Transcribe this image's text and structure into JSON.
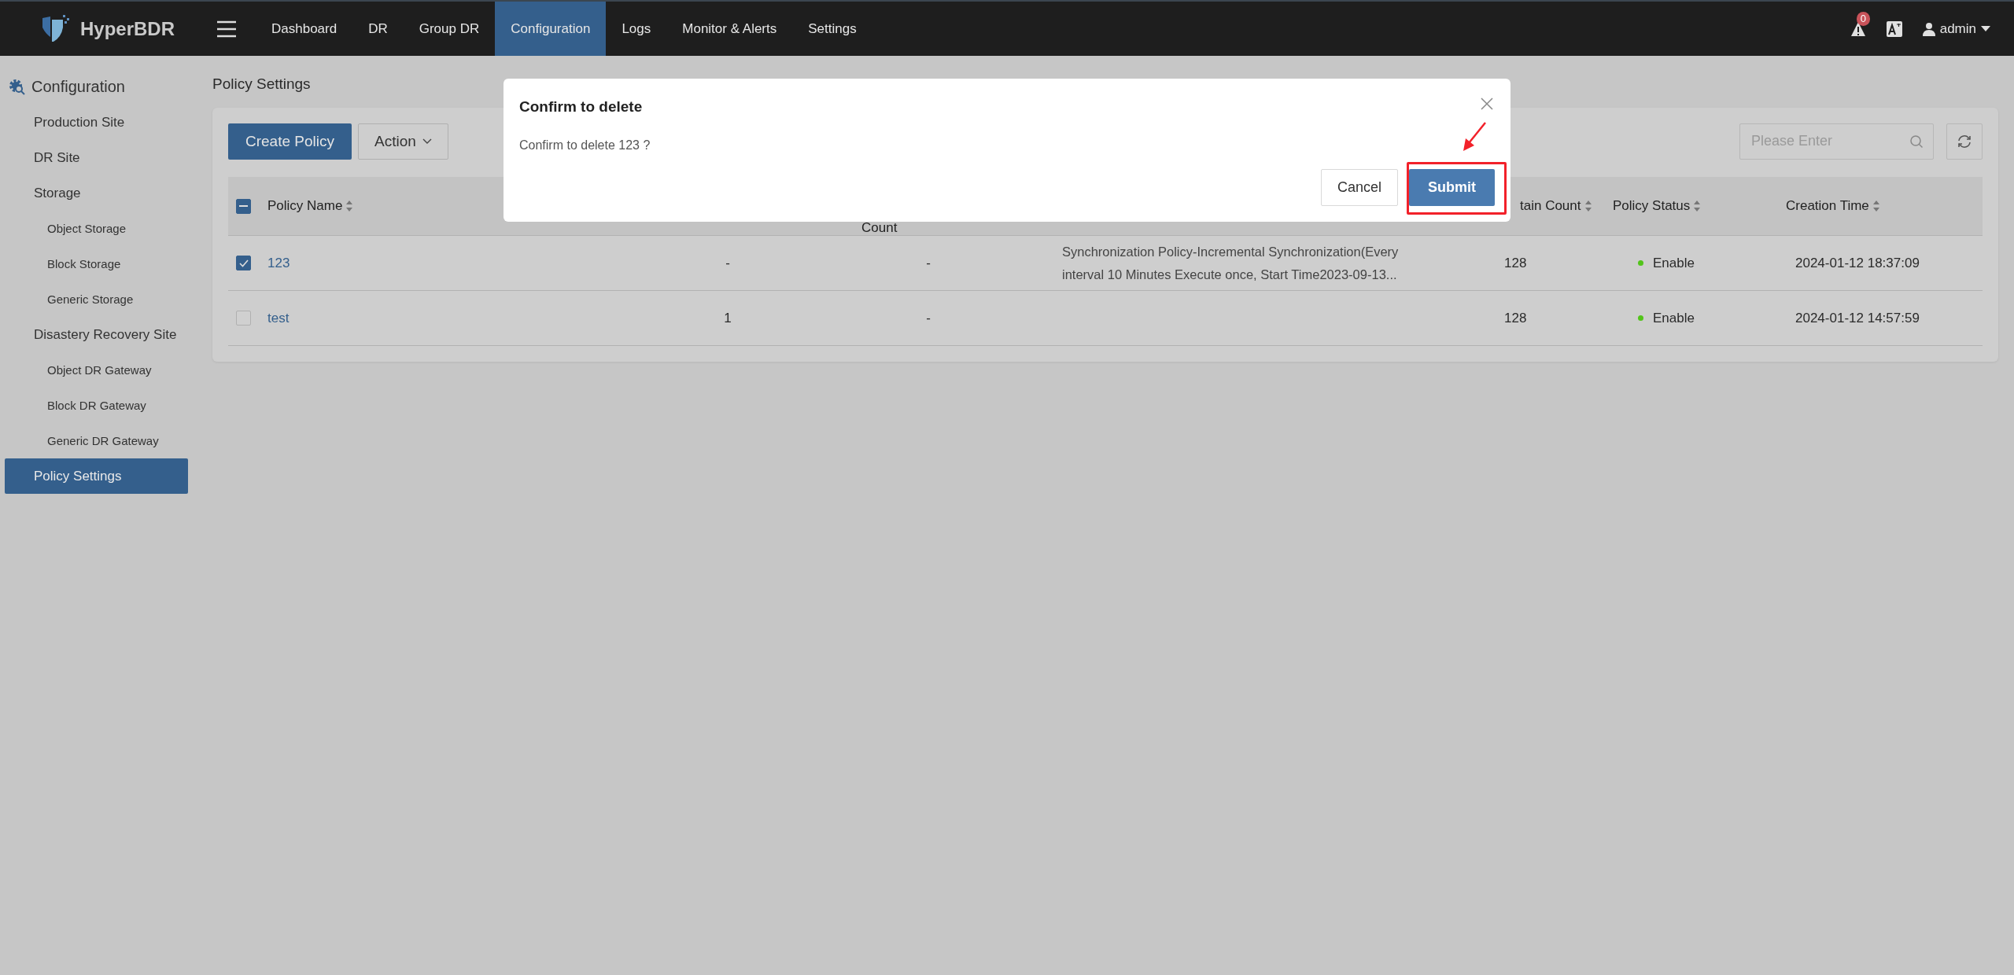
{
  "app": {
    "name": "HyperBDR"
  },
  "nav": [
    {
      "label": "Dashboard",
      "selected": false
    },
    {
      "label": "DR",
      "selected": false
    },
    {
      "label": "Group DR",
      "selected": false
    },
    {
      "label": "Configuration",
      "selected": true
    },
    {
      "label": "Logs",
      "selected": false
    },
    {
      "label": "Monitor & Alerts",
      "selected": false
    },
    {
      "label": "Settings",
      "selected": false
    }
  ],
  "topbar": {
    "alert_count": "0",
    "user": "admin"
  },
  "sidebar": {
    "title": "Configuration",
    "items": [
      {
        "label": "Production Site",
        "selected": false
      },
      {
        "label": "DR Site",
        "selected": false
      },
      {
        "label": "Storage",
        "selected": false,
        "children": [
          {
            "label": "Object Storage",
            "selected": false
          },
          {
            "label": "Block Storage",
            "selected": false
          },
          {
            "label": "Generic Storage",
            "selected": false
          }
        ]
      },
      {
        "label": "Disastery Recovery Site",
        "selected": false,
        "children": [
          {
            "label": "Object DR Gateway",
            "selected": false
          },
          {
            "label": "Block DR Gateway",
            "selected": false
          },
          {
            "label": "Generic DR Gateway",
            "selected": false
          }
        ]
      },
      {
        "label": "Policy Settings",
        "selected": true
      }
    ]
  },
  "page_title": "Policy Settings",
  "toolbar": {
    "create_button": "Create Policy",
    "action_button": "Action",
    "search": {
      "placeholder": "Please Enter"
    }
  },
  "table": {
    "select_all": {
      "indeterminate": true
    },
    "header": {
      "policy_name": "Policy Name",
      "column_3": "Count",
      "retain_count": "tain Count",
      "policy_status": "Policy Status",
      "creation_time": "Creation Time"
    },
    "rows": [
      {
        "checked": true,
        "policy_name": "123",
        "column_2": "-",
        "column_3": "-",
        "column_4": "Synchronization Policy-Incremental Synchronization(Every interval 10 Minutes Execute once, Start Time2023-09-13...",
        "retain_count": "128",
        "status": {
          "label": "Enable",
          "color": "#52c41a"
        },
        "creation_time": "2024-01-12 18:37:09"
      },
      {
        "checked": false,
        "policy_name": "test",
        "column_2": "1",
        "column_3": "-",
        "retain_count": "128",
        "status": {
          "label": "Enable",
          "color": "#52c41a"
        },
        "creation_time": "2024-01-12 14:57:59"
      }
    ]
  },
  "dialog": {
    "title": "Confirm to delete",
    "message": "Confirm to delete 123 ?",
    "cancel": "Cancel",
    "submit": "Submit"
  }
}
